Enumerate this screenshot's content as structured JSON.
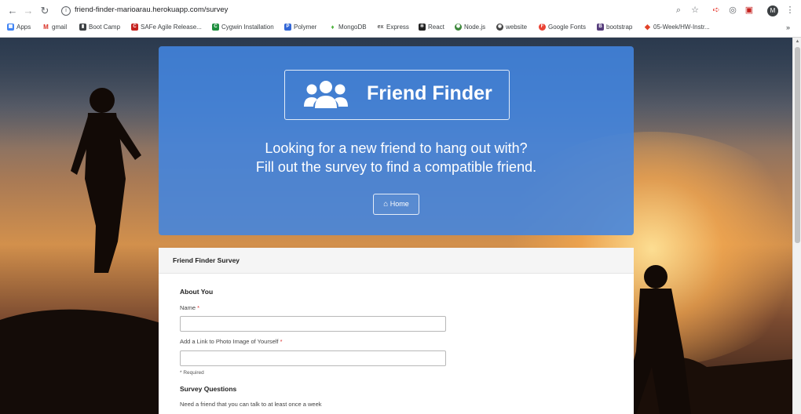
{
  "browser": {
    "url": "friend-finder-marioarau.herokuapp.com/survey",
    "avatar_letter": "M",
    "bookmarks": [
      {
        "label": "Apps",
        "icon": "apps-grid-icon",
        "color": "#4285f4"
      },
      {
        "label": "gmail",
        "icon": "gmail-icon",
        "color": "#d93025"
      },
      {
        "label": "Boot Camp",
        "icon": "book-icon",
        "color": "#3c4043"
      },
      {
        "label": "SAFe Agile Release...",
        "icon": "safe-icon",
        "color": "#c5221f"
      },
      {
        "label": "Cygwin Installation",
        "icon": "cygwin-icon",
        "color": "#1e8e3e"
      },
      {
        "label": "Polymer",
        "icon": "polymer-icon",
        "color": "#3367d6"
      },
      {
        "label": "MongoDB",
        "icon": "mongodb-leaf-icon",
        "color": "#4db33d"
      },
      {
        "label": "Express",
        "icon": "express-icon",
        "color": "#555555"
      },
      {
        "label": "React",
        "icon": "react-icon",
        "color": "#222222"
      },
      {
        "label": "Node.js",
        "icon": "nodejs-icon",
        "color": "#3c873a"
      },
      {
        "label": "website",
        "icon": "globe-icon",
        "color": "#444444"
      },
      {
        "label": "Google Fonts",
        "icon": "google-fonts-icon",
        "color": "#ea4335"
      },
      {
        "label": "bootstrap",
        "icon": "bootstrap-icon",
        "color": "#563d7c"
      },
      {
        "label": "05-Week/HW-Instr...",
        "icon": "gitlab-icon",
        "color": "#e24329"
      }
    ],
    "more_bookmarks": "»"
  },
  "jumbotron": {
    "title": "Friend Finder",
    "tagline_line1": "Looking for a new friend to hang out with?",
    "tagline_line2": "Fill out the survey to find a compatible friend.",
    "home_button": "Home"
  },
  "survey": {
    "panel_title": "Friend Finder Survey",
    "about_heading": "About You",
    "name_label": "Name",
    "name_value": "",
    "photo_label": "Add a Link to Photo Image of Yourself",
    "photo_value": "",
    "required_star": "*",
    "required_note": "* Required",
    "questions_heading": "Survey Questions",
    "question_1": "Need a friend that you can talk to at least once a week"
  },
  "colors": {
    "jumbotron": "#4285e0",
    "panel_header": "#f5f5f5"
  }
}
